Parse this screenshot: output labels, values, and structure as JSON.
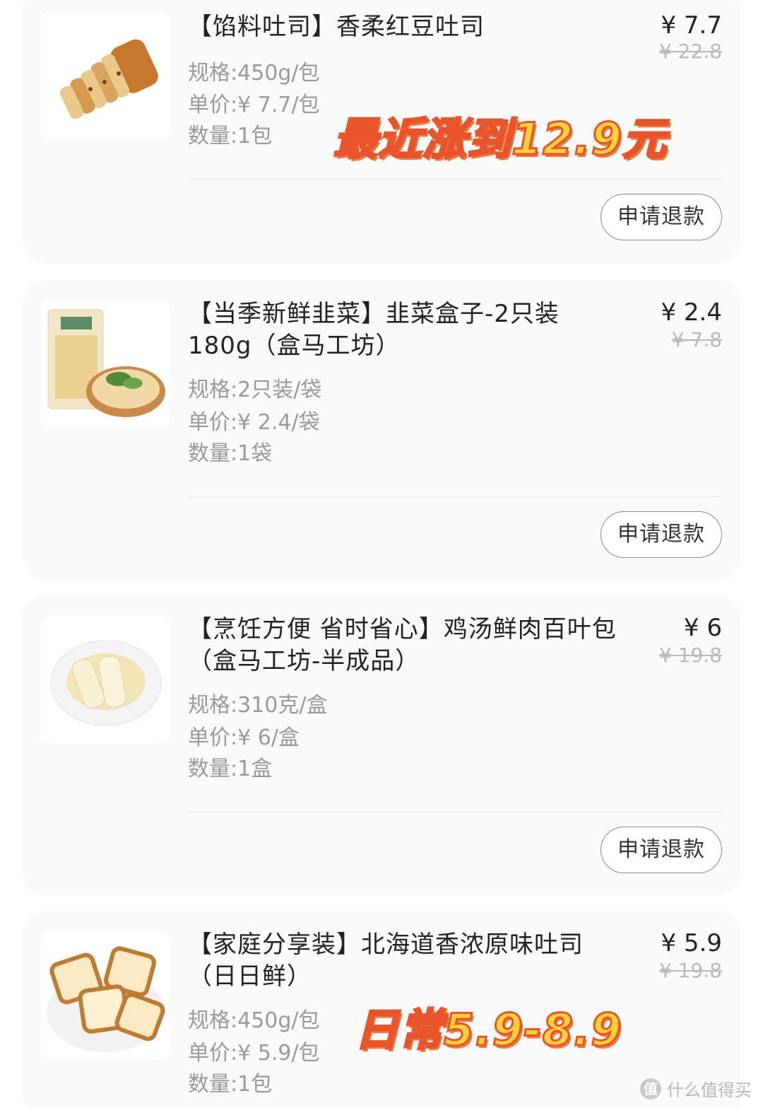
{
  "items": [
    {
      "title": "【馅料吐司】香柔红豆吐司",
      "price": "¥ 7.7",
      "original_price": "¥ 22.8",
      "spec": "规格:450g/包",
      "unit_price": "单价:¥ 7.7/包",
      "quantity": "数量:1包",
      "refund_label": "申请退款",
      "overlay_note": "最近涨到12.9元"
    },
    {
      "title": "【当季新鲜韭菜】韭菜盒子-2只装\n180g（盒马工坊）",
      "price": "¥ 2.4",
      "original_price": "¥ 7.8",
      "spec": "规格:2只装/袋",
      "unit_price": "单价:¥ 2.4/袋",
      "quantity": "数量:1袋",
      "refund_label": "申请退款"
    },
    {
      "title": "【烹饪方便 省时省心】鸡汤鲜肉百叶包\n（盒马工坊-半成品）",
      "price": "¥ 6",
      "original_price": "¥ 19.8",
      "spec": "规格:310克/盒",
      "unit_price": "单价:¥ 6/盒",
      "quantity": "数量:1盒",
      "refund_label": "申请退款"
    },
    {
      "title": "【家庭分享装】北海道香浓原味吐司\n（日日鲜）",
      "price": "¥ 5.9",
      "original_price": "¥ 19.8",
      "spec": "规格:450g/包",
      "unit_price": "单价:¥ 5.9/包",
      "quantity": "数量:1包",
      "overlay_note": "日常5.9-8.9"
    }
  ],
  "watermark": {
    "icon": "值",
    "text": "什么值得买"
  },
  "colors": {
    "overlay_fill": "#ffd23a",
    "overlay_stroke": "#e8542b",
    "card_bg": "#fafafa",
    "muted_text": "#9a9a9a"
  }
}
